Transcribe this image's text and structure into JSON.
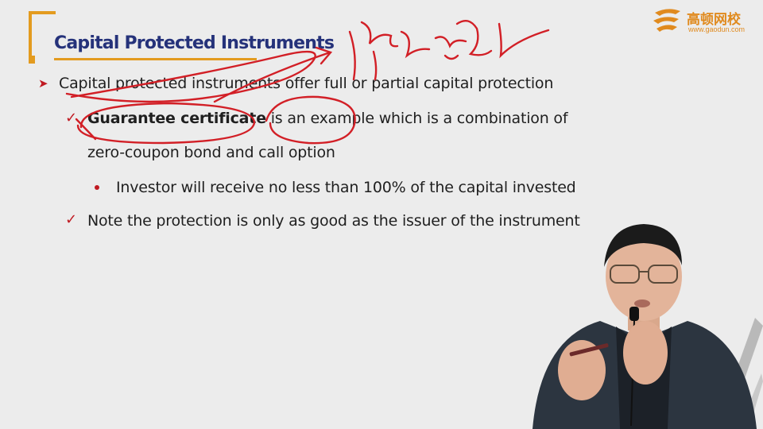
{
  "slide": {
    "title": "Capital Protected Instruments",
    "bullet_main": "Capital protected instruments offer full or partial capital protection",
    "sub1_bold": "Guarantee certificate",
    "sub1_rest": " is an example which is a combination of",
    "sub1_line2": "zero-coupon bond and call option",
    "sub1_point": "Investor will receive no less than 100% of the capital invested",
    "sub2": "Note the protection is only as good as the issuer of the instrument"
  },
  "logo": {
    "name": "高顿网校",
    "url": "www.gaodun.com"
  },
  "colors": {
    "title": "#25327a",
    "accent_orange": "#e39b1f",
    "bullet_red": "#c01a22",
    "annotation_red": "#d21f26"
  },
  "icons": {
    "main_bullet": "arrow-bullet-icon",
    "sub_bullet": "checkmark-icon",
    "point_bullet": "dot-icon"
  }
}
